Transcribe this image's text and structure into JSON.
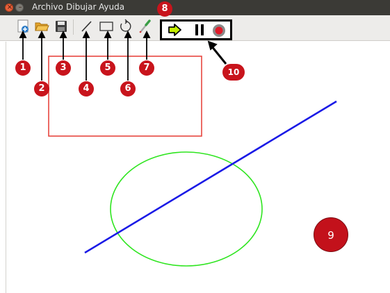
{
  "window": {
    "close_glyph": "×",
    "min_glyph": "–"
  },
  "menu": {
    "items": [
      "Archivo",
      "Dibujar",
      "Ayuda"
    ]
  },
  "toolbar": {
    "icons": [
      "new-icon",
      "open-folder-icon",
      "save-icon",
      "line-tool-icon",
      "rectangle-tool-icon",
      "circle-tool-icon",
      "color-picker-icon"
    ],
    "media": [
      "play-icon",
      "pause-icon",
      "record-icon"
    ]
  },
  "annotations": {
    "labels": [
      "1",
      "2",
      "3",
      "4",
      "5",
      "6",
      "7",
      "8",
      "9",
      "10"
    ],
    "color": "#c8141c"
  },
  "canvas": {
    "shapes": [
      {
        "type": "rectangle",
        "color": "#e8463f"
      },
      {
        "type": "ellipse",
        "color": "#2ee51f"
      },
      {
        "type": "line",
        "color": "#1a1ae6"
      }
    ]
  }
}
